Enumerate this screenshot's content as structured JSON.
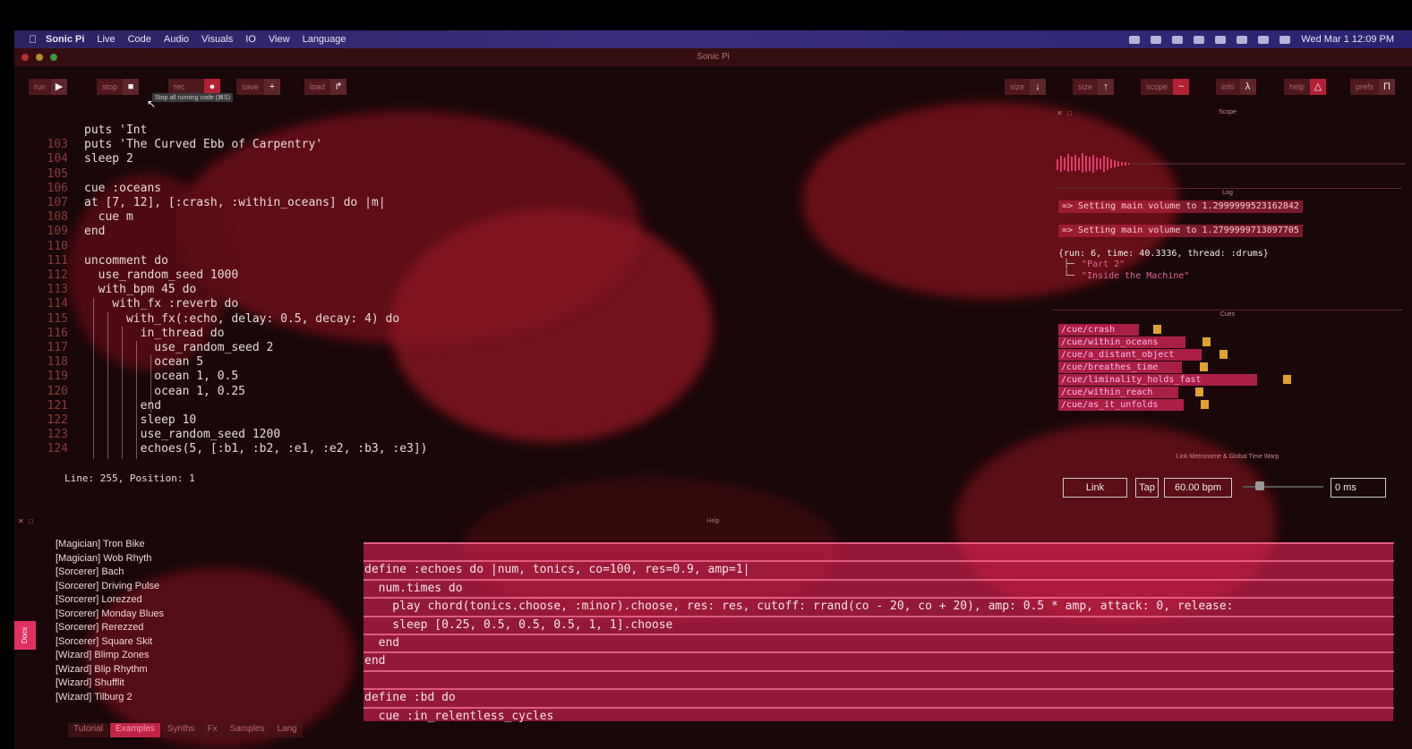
{
  "menubar": {
    "app_name": "Sonic Pi",
    "items": [
      "Live",
      "Code",
      "Audio",
      "Visuals",
      "IO",
      "View",
      "Language"
    ],
    "clock": "Wed Mar 1  12:09 PM"
  },
  "window": {
    "title": "Sonic Pi"
  },
  "toolbar": {
    "run_label": "run",
    "stop_label": "stop",
    "rec_label": "rec",
    "save_label": "save",
    "load_label": "load",
    "stop_tooltip": "Stop all running code (⌘S)",
    "size_down_label": "size",
    "size_up_label": "size",
    "scope_label": "scope",
    "info_label": "info",
    "help_label": "help",
    "prefs_label": "prefs"
  },
  "editor": {
    "lines": [
      {
        "n": "",
        "text": "puts 'Int"
      },
      {
        "n": "103",
        "text": "puts 'The Curved Ebb of Carpentry'"
      },
      {
        "n": "104",
        "text": "sleep 2"
      },
      {
        "n": "105",
        "text": ""
      },
      {
        "n": "106",
        "text": "cue :oceans"
      },
      {
        "n": "107",
        "text": "at [7, 12], [:crash, :within_oceans] do |m|"
      },
      {
        "n": "108",
        "text": "  cue m"
      },
      {
        "n": "109",
        "text": "end"
      },
      {
        "n": "110",
        "text": ""
      },
      {
        "n": "111",
        "text": "uncomment do"
      },
      {
        "n": "112",
        "text": "  use_random_seed 1000"
      },
      {
        "n": "113",
        "text": "  with_bpm 45 do"
      },
      {
        "n": "114",
        "text": "    with_fx :reverb do"
      },
      {
        "n": "115",
        "text": "      with_fx(:echo, delay: 0.5, decay: 4) do"
      },
      {
        "n": "116",
        "text": "        in_thread do"
      },
      {
        "n": "117",
        "text": "          use_random_seed 2"
      },
      {
        "n": "118",
        "text": "          ocean 5"
      },
      {
        "n": "119",
        "text": "          ocean 1, 0.5"
      },
      {
        "n": "120",
        "text": "          ocean 1, 0.25"
      },
      {
        "n": "121",
        "text": "        end"
      },
      {
        "n": "122",
        "text": "        sleep 10"
      },
      {
        "n": "123",
        "text": "        use_random_seed 1200"
      },
      {
        "n": "124",
        "text": "        echoes(5, [:b1, :b2, :e1, :e2, :b3, :e3])"
      }
    ],
    "status": "Line: 255,  Position: 1"
  },
  "scope": {
    "title": "Scope"
  },
  "log": {
    "title": "Log",
    "lines": [
      "=> Setting main volume to 1.2999999523162842",
      "=> Setting main volume to 1.2799999713897705"
    ],
    "run_info": "{run: 6, time: 40.3336, thread: :drums}",
    "run_items": [
      "\"Part 2\"",
      "\"Inside the Machine\""
    ]
  },
  "cues": {
    "title": "Cues",
    "items": [
      "/cue/crash",
      "/cue/within_oceans",
      "/cue/a_distant_object",
      "/cue/breathes_time",
      "/cue/liminality_holds_fast",
      "/cue/within_reach",
      "/cue/as_it_unfolds"
    ]
  },
  "link": {
    "title": "Link Metronome & Global Time Warp",
    "link_label": "Link",
    "tap_label": "Tap",
    "bpm_value": "60.00 bpm",
    "warp_value": "0 ms"
  },
  "help": {
    "title": "Help",
    "docs_label": "Docs",
    "examples": [
      "[Magician] Tron Bike",
      "[Magician] Wob Rhyth",
      "[Sorcerer] Bach",
      "[Sorcerer] Driving Pulse",
      "[Sorcerer] Lorezzed",
      "[Sorcerer] Monday Blues",
      "[Sorcerer] Rerezzed",
      "[Sorcerer] Square Skit",
      "[Wizard] Blimp Zones",
      "[Wizard] Blip Rhythm",
      "[Wizard] Shufflit",
      "[Wizard] Tilburg 2"
    ],
    "tabs": [
      "Tutorial",
      "Examples",
      "Synths",
      "Fx",
      "Samples",
      "Lang"
    ],
    "active_tab": "Examples",
    "doc_lines": [
      "",
      "define :echoes do |num, tonics, co=100, res=0.9, amp=1|",
      "  num.times do",
      "    play chord(tonics.choose, :minor).choose, res: res, cutoff: rrand(co - 20, co + 20), amp: 0.5 * amp, attack: 0, release:",
      "    sleep [0.25, 0.5, 0.5, 0.5, 1, 1].choose",
      "  end",
      "end",
      "",
      "define :bd do",
      "  cue :in_relentless_cycles"
    ]
  },
  "colors": {
    "accent": "#e0285a",
    "background": "#1a0709",
    "menubar": "#32296e"
  }
}
